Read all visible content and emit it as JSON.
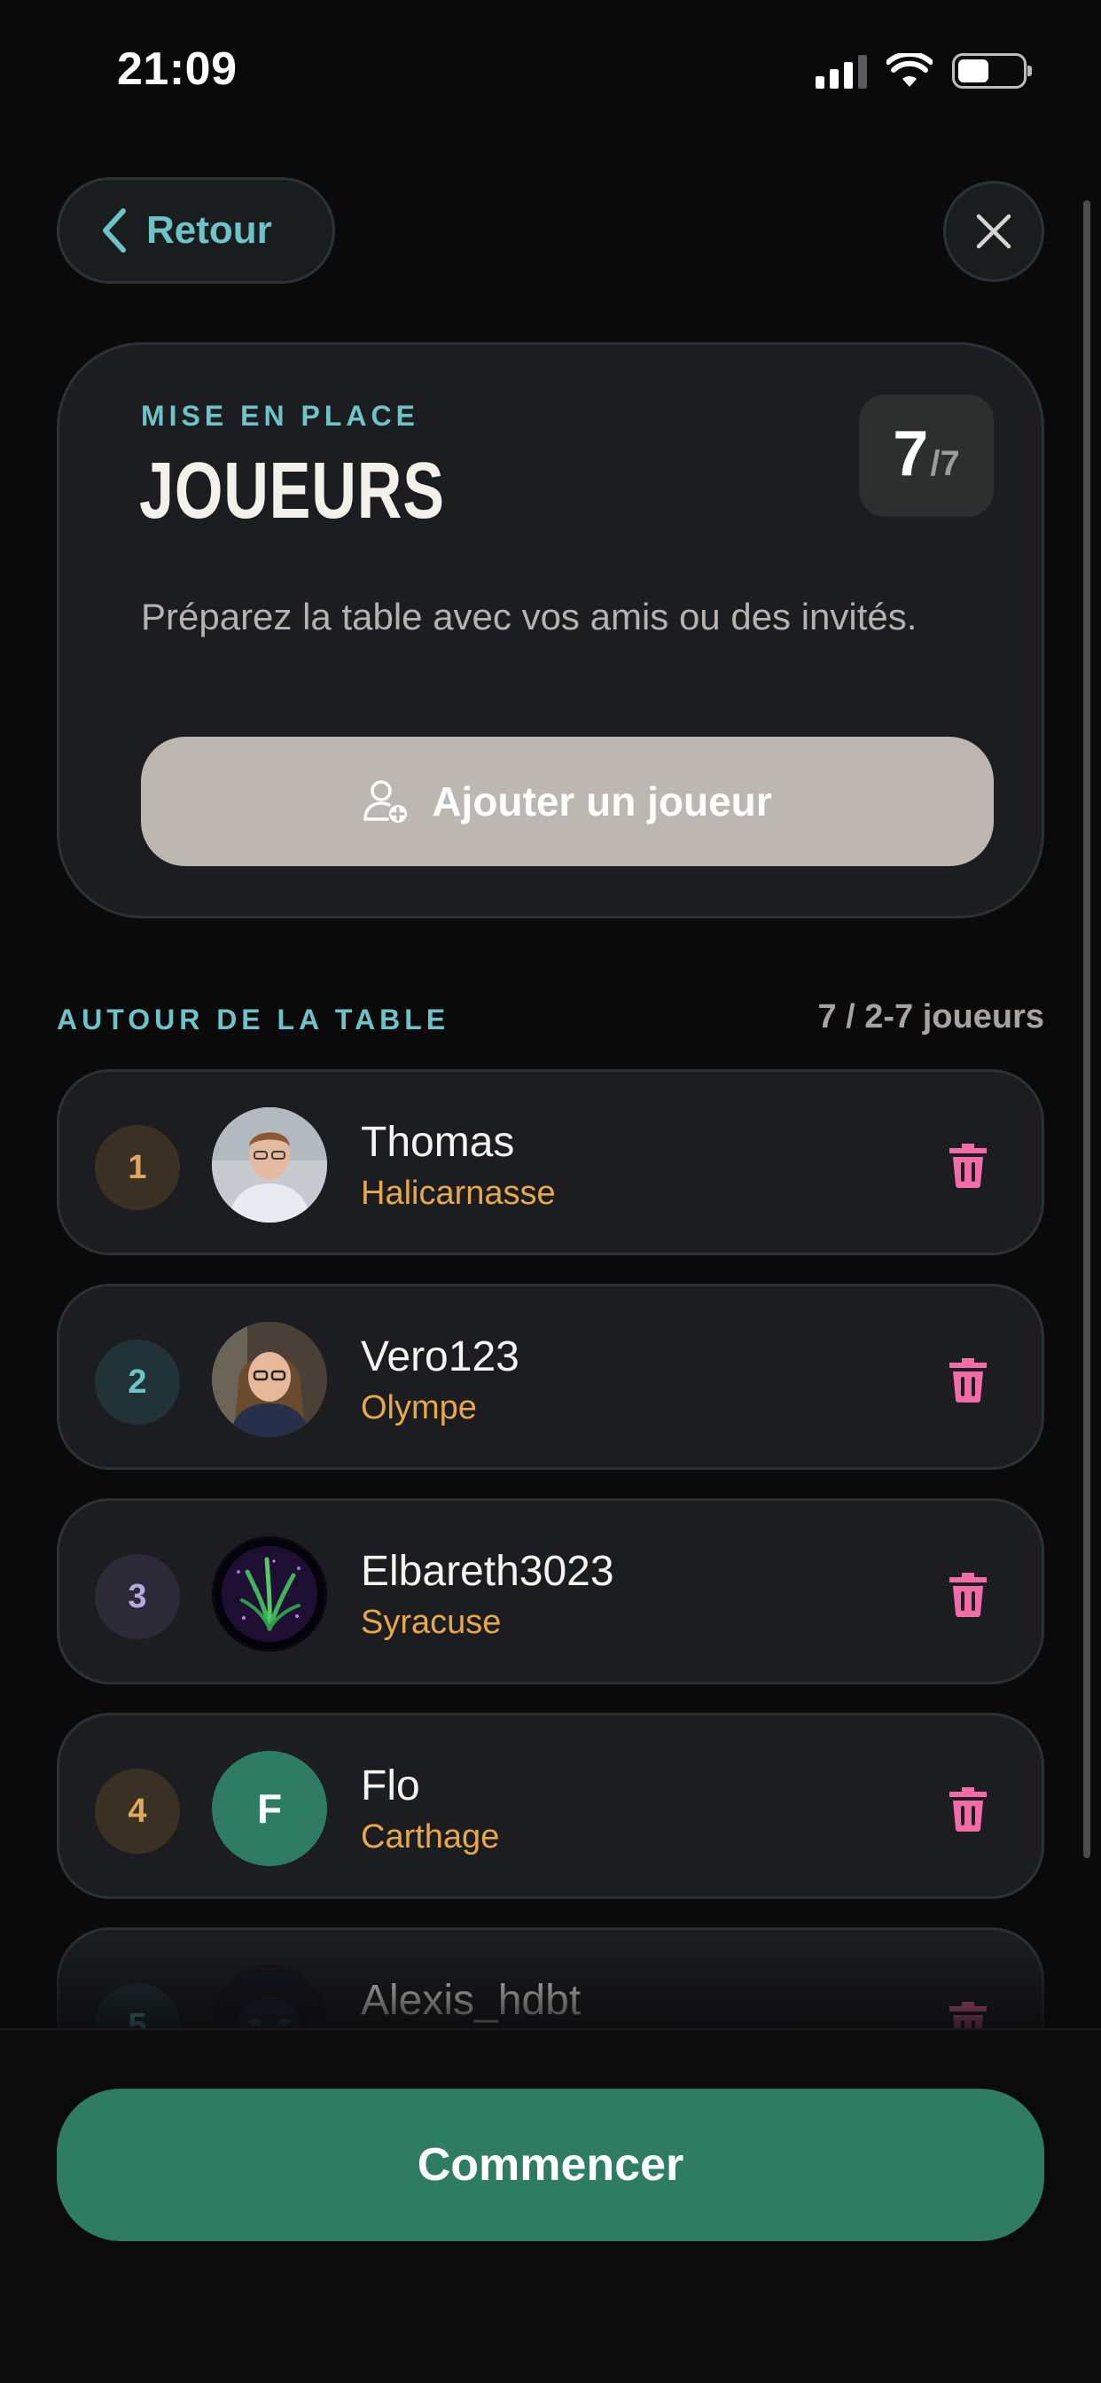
{
  "status_bar": {
    "time": "21:09"
  },
  "nav": {
    "back_label": "Retour"
  },
  "setup_card": {
    "eyebrow": "MISE EN PLACE",
    "title": "JOUEURS",
    "count_current": "7",
    "count_max": "/7",
    "description": "Préparez la table avec vos amis ou des invités.",
    "add_player_label": "Ajouter un joueur"
  },
  "section": {
    "label": "AUTOUR DE LA TABLE",
    "count": "7 / 2-7 joueurs"
  },
  "players": [
    {
      "rank": "1",
      "name": "Thomas",
      "city": "Halicarnasse",
      "avatar": "photo"
    },
    {
      "rank": "2",
      "name": "Vero123",
      "city": "Olympe",
      "avatar": "photo"
    },
    {
      "rank": "3",
      "name": "Elbareth3023",
      "city": "Syracuse",
      "avatar": "plant-image"
    },
    {
      "rank": "4",
      "name": "Flo",
      "city": "Carthage",
      "avatar": "initial",
      "initial": "F"
    },
    {
      "rank": "5",
      "name": "Alexis_hdbt",
      "city": "",
      "avatar": "photo"
    }
  ],
  "footer": {
    "start_label": "Commencer"
  },
  "colors": {
    "accent_teal": "#6ec3c9",
    "city_orange": "#e6a84a",
    "delete_pink": "#f26ca7",
    "start_green": "#2e7d62",
    "add_button_gray": "#bcb8b1"
  }
}
